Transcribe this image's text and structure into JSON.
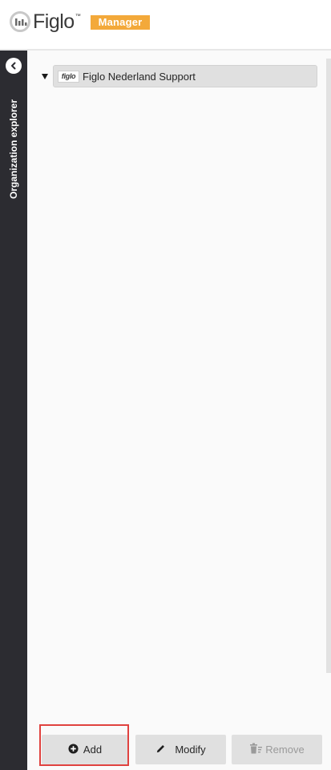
{
  "app": {
    "logo_text": "Figlo",
    "logo_tm": "™",
    "badge": "Manager"
  },
  "sidebar": {
    "label": "Organization explorer",
    "collapse_icon": "chevron-left-icon"
  },
  "tree": {
    "nodes": [
      {
        "logo_text": "figlo",
        "label": "Figlo Nederland Support",
        "expanded": true
      }
    ]
  },
  "actions": {
    "add": {
      "label": "Add",
      "icon": "plus-circle-icon",
      "enabled": true
    },
    "modify": {
      "label": "Modify",
      "icon": "pencil-icon",
      "enabled": true
    },
    "remove": {
      "label": "Remove",
      "icon": "trash-icon",
      "enabled": false
    }
  },
  "colors": {
    "accent": "#f3a93a",
    "sidebar": "#2c2c31",
    "highlight": "#e0423f"
  }
}
